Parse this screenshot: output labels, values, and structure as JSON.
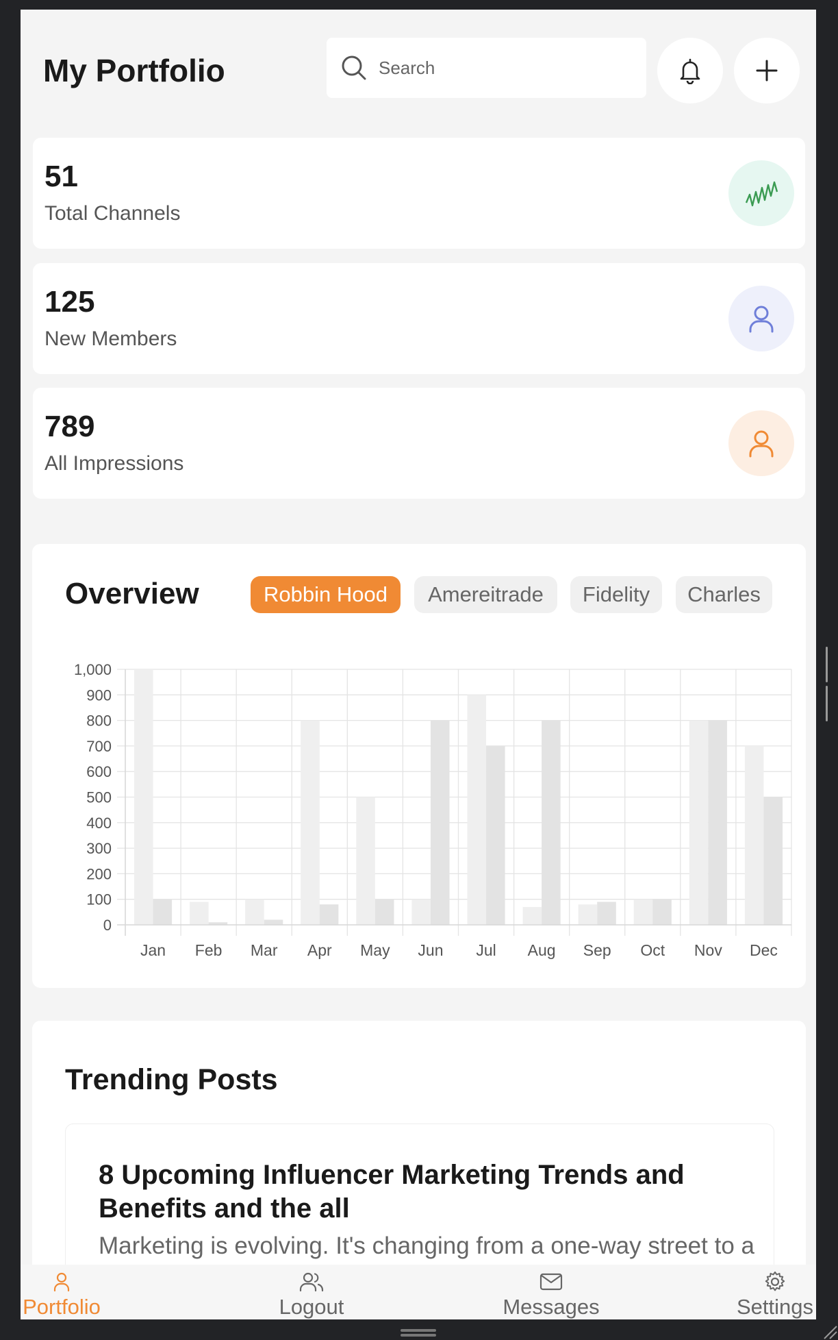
{
  "header": {
    "title": "My Portfolio",
    "search_placeholder": "Search",
    "icons": [
      "search-icon",
      "bell-icon",
      "plus-icon"
    ]
  },
  "stats": [
    {
      "value": "51",
      "label": "Total Channels",
      "icon": "zigzag-icon",
      "bg": "#e6f7f1",
      "color": "#3a9b52"
    },
    {
      "value": "125",
      "label": "New Members",
      "icon": "user-icon",
      "bg": "#eef0fb",
      "color": "#6f7fd9"
    },
    {
      "value": "789",
      "label": "All Impressions",
      "icon": "user-icon",
      "bg": "#fdeee2",
      "color": "#f08a34"
    }
  ],
  "overview": {
    "title": "Overview",
    "tabs": [
      "Robbin Hood",
      "Amereitrade",
      "Fidelity",
      "Charles"
    ],
    "active_tab": "Robbin Hood"
  },
  "chart_data": {
    "type": "bar",
    "categories": [
      "Jan",
      "Feb",
      "Mar",
      "Apr",
      "May",
      "Jun",
      "Jul",
      "Aug",
      "Sep",
      "Oct",
      "Nov",
      "Dec"
    ],
    "series": [
      {
        "values": [
          1000,
          90,
          100,
          800,
          500,
          100,
          900,
          70,
          80,
          100,
          800,
          700
        ],
        "color": "#efefef"
      },
      {
        "values": [
          100,
          10,
          20,
          80,
          100,
          800,
          700,
          800,
          90,
          100,
          800,
          500
        ],
        "color": "#e3e3e3"
      }
    ],
    "yticks": [
      "1,000",
      "900",
      "800",
      "700",
      "600",
      "500",
      "400",
      "300",
      "200",
      "100",
      "0"
    ],
    "ylim": [
      0,
      1000
    ],
    "grid": true
  },
  "trending": {
    "title": "Trending Posts",
    "posts": [
      {
        "title": "8 Upcoming Influencer Marketing Trends and Benefits and the all",
        "excerpt": "Marketing is evolving. It's changing from a one-way street to a"
      }
    ]
  },
  "nav": {
    "items": [
      {
        "label": "Portfolio",
        "icon": "user-icon"
      },
      {
        "label": "Logout",
        "icon": "users-icon"
      },
      {
        "label": "Messages",
        "icon": "mail-icon"
      },
      {
        "label": "Settings",
        "icon": "gear-icon"
      }
    ],
    "active": "Portfolio",
    "accent": "#f08a34"
  }
}
